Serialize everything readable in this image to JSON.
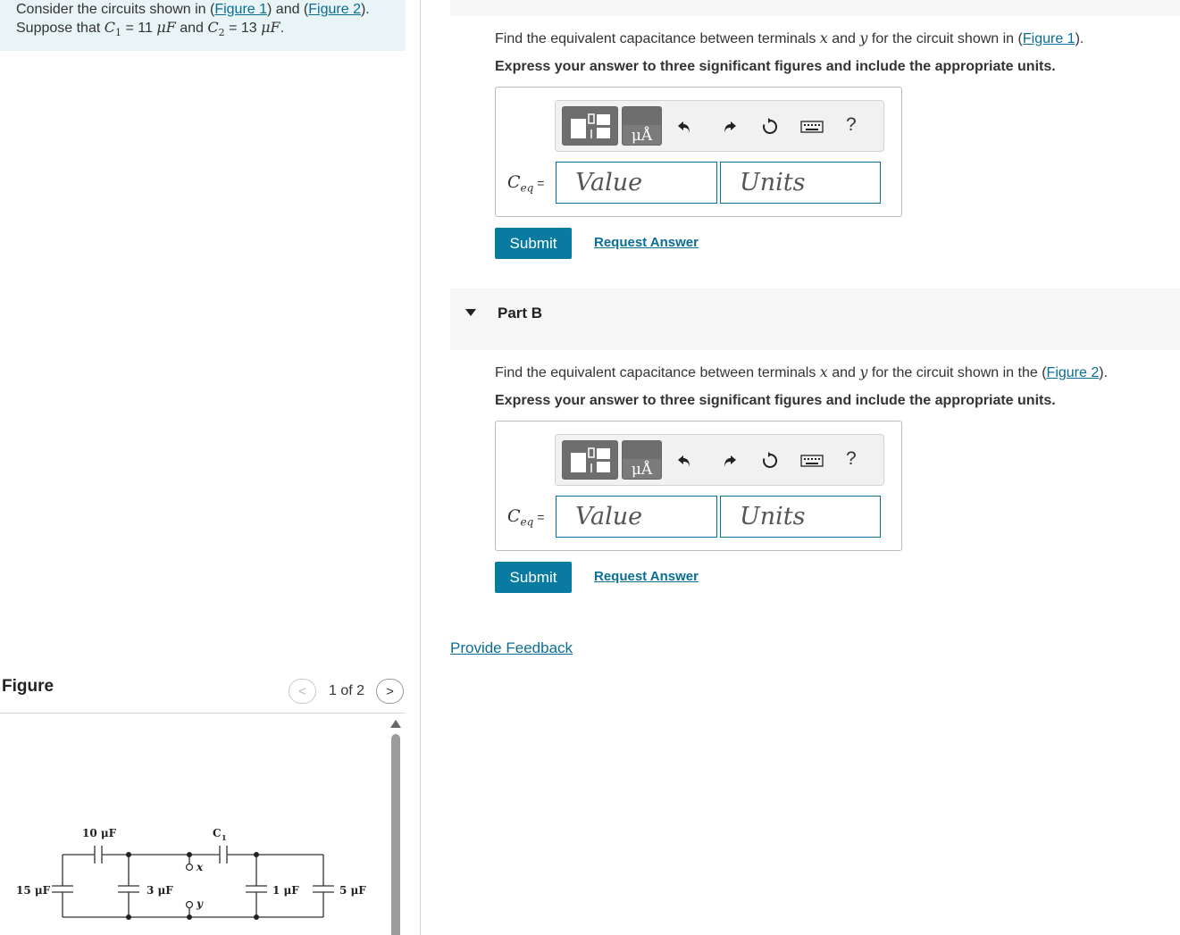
{
  "intro": {
    "line1_a": "Consider the circuits shown in (",
    "figure1_link": "Figure 1",
    "line1_b": ") and (",
    "figure2_link": "Figure 2",
    "line1_c": ").",
    "line2_a": "Suppose that ",
    "c1": "C",
    "c1_sub": "1",
    "c1_value": " = 11 ",
    "unit": "μF",
    "line2_b": " and ",
    "c2": "C",
    "c2_sub": "2",
    "c2_value": " = 13 ",
    "line2_end": "."
  },
  "part_a": {
    "question_a": "Find the equivalent capacitance between terminals ",
    "x": "x",
    "and": " and ",
    "y": "y",
    "question_b": " for the circuit shown in (",
    "figure_link": "Figure 1",
    "question_c": ").",
    "instruction": "Express your answer to three significant figures and include the appropriate units.",
    "ceq_symbol": "C",
    "ceq_sub": "eq",
    "ceq_equals": " =",
    "value_placeholder": "Value",
    "units_placeholder": "Units",
    "submit": "Submit",
    "request_answer": "Request Answer"
  },
  "part_b": {
    "label": "Part B",
    "question_a": "Find the equivalent capacitance between terminals ",
    "x": "x",
    "and": " and ",
    "y": "y",
    "question_b": " for the circuit shown in the (",
    "figure_link": "Figure 2",
    "question_c": ").",
    "instruction": "Express your answer to three significant figures and include the appropriate units.",
    "ceq_symbol": "C",
    "ceq_sub": "eq",
    "ceq_equals": " =",
    "value_placeholder": "Value",
    "units_placeholder": "Units",
    "submit": "Submit",
    "request_answer": "Request Answer"
  },
  "toolbar": {
    "units_button": "μÅ",
    "help": "?"
  },
  "feedback": "Provide Feedback",
  "figure": {
    "title": "Figure",
    "counter": "1 of 2",
    "prev": "<",
    "next": ">",
    "labels": {
      "c10": "10 μF",
      "c1": "C",
      "c1_sub": "1",
      "c15": "15 μF",
      "c3": "3 μF",
      "c1uf": "1 μF",
      "c5": "5 μF",
      "x": "x",
      "y": "y"
    }
  },
  "colors": {
    "link": "#0a6e93",
    "submit": "#0a7ba0",
    "intro_bg": "#e8f4f6"
  }
}
